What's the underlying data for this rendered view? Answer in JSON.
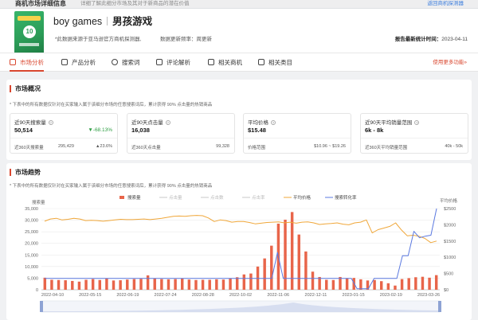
{
  "topbar": {
    "title": "商机市场详细信息",
    "subtitle": "详细了解此细分市场及其对于新商品的潜在价值",
    "back_label": "返回商机探测器"
  },
  "header": {
    "name_en": "boy games",
    "name_cn": "男孩游戏",
    "note_source": "*此数据来源于亚马逊官方商机探测器,",
    "note_freq": "数据更新频率：周更新",
    "stat_date_label": "报告最新统计时间：",
    "stat_date": "2023-04-11",
    "thumb_text": "10"
  },
  "tabs": [
    {
      "label": "市场分析",
      "icon": "chart-icon",
      "active": true
    },
    {
      "label": "产品分析",
      "icon": "box-icon"
    },
    {
      "label": "搜索词",
      "icon": "search-icon"
    },
    {
      "label": "评论解析",
      "icon": "comment-icon"
    },
    {
      "label": "相关商机",
      "icon": "opportunity-icon"
    },
    {
      "label": "相关类目",
      "icon": "category-icon"
    }
  ],
  "tabs_more": "使用更多功能»",
  "overview": {
    "title": "市场概况",
    "note": "* 下表中的所有数据仅针对在买家输入属于该细分市场的任意搜索词后，累计获得 90% 点击量的热销商品",
    "cards": [
      {
        "label": "近90天搜索量",
        "value": "50,514",
        "change": "▼-68.13%",
        "change_dir": "down",
        "sub_label": "近360天搜索量",
        "sub_value": "295,429",
        "sub_change": "▲23.6%",
        "sub_dir": "up"
      },
      {
        "label": "近90天点击量",
        "value": "16,038",
        "change": "",
        "sub_label": "近360天点击量",
        "sub_value": "99,328",
        "sub_change": ""
      },
      {
        "label": "平均价格",
        "value": "$15.48",
        "change": "",
        "sub_label": "价格范围",
        "sub_value": "$10.96 ~ $19.26",
        "sub_change": ""
      },
      {
        "label": "近90天平均销量范围",
        "value": "6k - 8k",
        "change": "",
        "sub_label": "近360天平均销量范围",
        "sub_value": "40k - 50k",
        "sub_change": ""
      }
    ]
  },
  "trend": {
    "title": "市场趋势",
    "note": "* 下表中的所有数据仅针对在买家输入属于该细分市场的任意搜索词后，累计获得 90% 点击量的热销商品"
  },
  "colors": {
    "accent": "#d9472f",
    "bar": "#e8654a",
    "avg_price": "#f0a73a",
    "conversion": "#5b79e0"
  },
  "chart_data": {
    "type": "bar",
    "title": "",
    "legend": [
      "搜索量",
      "点击量",
      "点击数",
      "点击率",
      "平均价格",
      "搜索转化率"
    ],
    "legend_active": [
      true,
      false,
      false,
      false,
      true,
      true
    ],
    "y_left_label": "搜索量",
    "y_right_label": "平均价格",
    "y_left_ticks": [
      "0",
      "5,000",
      "10,000",
      "15,000",
      "20,000",
      "25,000",
      "30,000",
      "35,000"
    ],
    "y_right_ticks": [
      "$0",
      "$500",
      "$1000",
      "$1500",
      "$2000",
      "$2500"
    ],
    "ylim_left": [
      0,
      35000
    ],
    "ylim_right": [
      0,
      2500
    ],
    "x_ticks": [
      "2022-04-10",
      "2022-05-15",
      "2022-06-19",
      "2022-07-24",
      "2022-08-28",
      "2022-10-02",
      "2022-11-06",
      "2022-12-11",
      "2023-01-15",
      "2023-02-19",
      "2023-03-26"
    ],
    "series": [
      {
        "name": "搜索量",
        "type": "bar",
        "values": [
          5200,
          4300,
          4200,
          4100,
          3800,
          3500,
          4300,
          4600,
          4200,
          4800,
          4000,
          4100,
          4400,
          4600,
          4700,
          6200,
          4800,
          4600,
          4500,
          4600,
          4800,
          4400,
          4200,
          4300,
          4300,
          4500,
          4400,
          4900,
          5400,
          6600,
          7000,
          10000,
          13500,
          19000,
          28500,
          30200,
          33500,
          23800,
          16500,
          7800,
          5500,
          4300,
          4200,
          5500,
          5000,
          5100,
          4500,
          4000,
          4200,
          3700,
          2800,
          1800,
          4600,
          5000,
          5400,
          5600,
          5200,
          6300
        ]
      },
      {
        "name": "平均价格",
        "type": "line",
        "values": [
          2110,
          2180,
          2200,
          2150,
          2170,
          2200,
          2180,
          2130,
          2140,
          2130,
          2110,
          2130,
          2150,
          2170,
          2160,
          2160,
          2170,
          2180,
          2160,
          2180,
          2200,
          2230,
          2260,
          2270,
          2260,
          2280,
          2290,
          2280,
          2210,
          2100,
          2150,
          2130,
          2080,
          2100,
          2100,
          2070,
          2030,
          2050,
          2070,
          2080,
          2090,
          2060,
          2080,
          2050,
          2080,
          2090,
          2060,
          2010,
          2030,
          2040,
          2060,
          2020,
          2000,
          2060,
          2080,
          2150,
          1750,
          1850,
          1900,
          1950,
          2060,
          1840,
          1660,
          1680,
          1650,
          1580,
          1450,
          1500
        ]
      },
      {
        "name": "搜索转化率",
        "type": "line",
        "values": [
          350,
          350,
          350,
          350,
          350,
          350,
          350,
          350,
          350,
          350,
          350,
          350,
          350,
          350,
          350,
          350,
          350,
          350,
          350,
          350,
          350,
          350,
          350,
          350,
          350,
          350,
          350,
          350,
          350,
          350,
          350,
          350,
          350,
          350,
          350,
          350,
          350,
          350,
          350,
          350,
          350,
          1150,
          350,
          350,
          350,
          350,
          350,
          350,
          350,
          350,
          350,
          350,
          350,
          350,
          350,
          30,
          30,
          30,
          350,
          350,
          350,
          350,
          350,
          1050,
          1050,
          1800,
          1600,
          1650,
          1680,
          2500
        ]
      }
    ]
  }
}
